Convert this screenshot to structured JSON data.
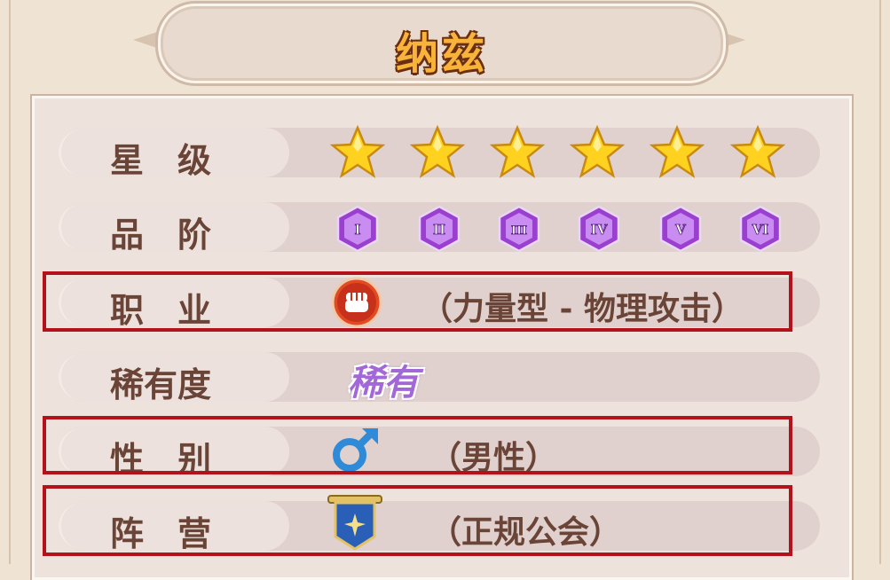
{
  "hero": {
    "name": "纳兹"
  },
  "rows": {
    "star_level": {
      "label": "星　级",
      "stars": 6
    },
    "tier": {
      "label": "品　阶",
      "tiers": [
        "I",
        "II",
        "III",
        "IV",
        "V",
        "VI"
      ]
    },
    "class": {
      "label": "职　业",
      "icon": "fist-icon",
      "value": "（力量型 - 物理攻击）"
    },
    "rarity": {
      "label": "稀有度",
      "value": "稀有"
    },
    "gender": {
      "label": "性　别",
      "icon": "male-icon",
      "value": "（男性）"
    },
    "faction": {
      "label": "阵　营",
      "icon": "banner-icon",
      "value": "（正规公会）"
    }
  },
  "colors": {
    "highlight": "#b4121a",
    "label_text": "#6a4537",
    "title": "#f7b33a",
    "star": "#ffd21f",
    "gem": "#9b3fd0",
    "rarity": "#a268d8"
  }
}
